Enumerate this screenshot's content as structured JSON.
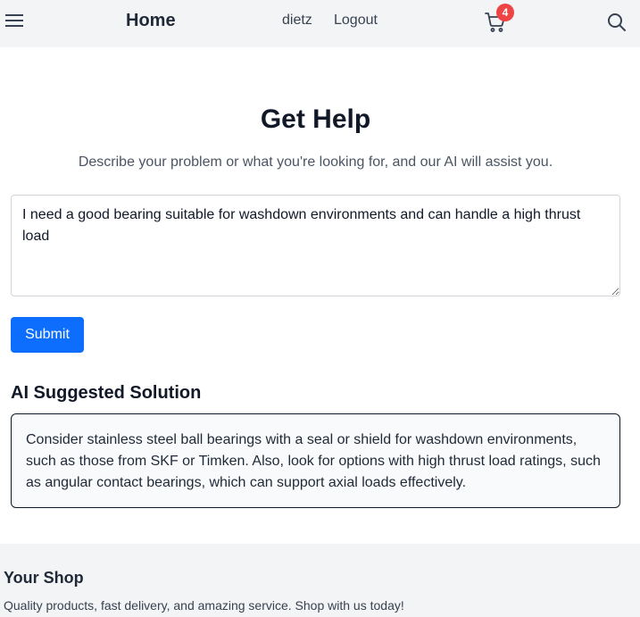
{
  "header": {
    "menu_icon": "hamburger-menu-icon",
    "brand": "Home",
    "user": "dietz",
    "logout": "Logout",
    "cart_icon": "shopping-cart-icon",
    "cart_count": "4",
    "search_icon": "search-icon"
  },
  "main": {
    "title": "Get Help",
    "subtitle": "Describe your problem or what you're looking for, and our AI will assist you.",
    "problem_value": "I need a good bearing suitable for washdown environments and can handle a high thrust load",
    "submit_label": "Submit",
    "ai_heading": "AI Suggested Solution",
    "ai_solution": "Consider stainless steel ball bearings with a seal or shield for washdown environments, such as those from SKF or Timken. Also, look for options with high thrust load ratings, such as angular contact bearings, which can support axial loads effectively."
  },
  "footer": {
    "title": "Your Shop",
    "tagline": "Quality products, fast delivery, and amazing service. Shop with us today!"
  },
  "colors": {
    "header_bg": "#f3f4f6",
    "primary_button": "#0d6efd",
    "badge": "#ef4444",
    "footer_bg": "#f3f4f6"
  }
}
